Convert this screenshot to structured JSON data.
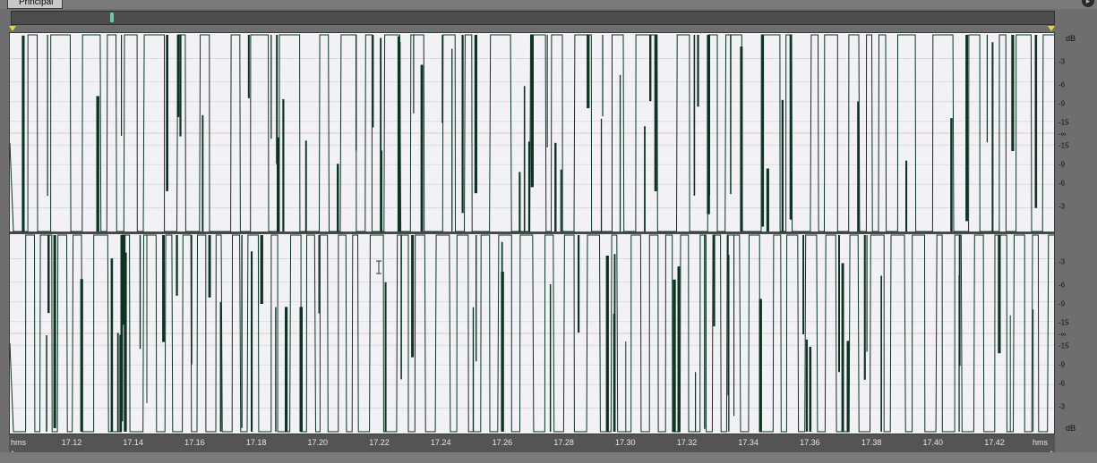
{
  "window": {
    "tab_label": "Principal"
  },
  "channels": [
    {
      "db_unit": "dB",
      "db_labels": [
        "-3",
        "-6",
        "-9",
        "-15",
        "-∞",
        "-15",
        "-9",
        "-6",
        "-3"
      ]
    },
    {
      "db_labels": [
        "-3",
        "-6",
        "-9",
        "-15",
        "-∞",
        "-15",
        "-9",
        "-6",
        "-3"
      ]
    }
  ],
  "time_ruler": {
    "unit_left": "hms",
    "unit_right": "hms",
    "ticks": [
      "17.12",
      "17.14",
      "17.16",
      "17.18",
      "17.20",
      "17.22",
      "17.24",
      "17.26",
      "17.28",
      "17.30",
      "17.32",
      "17.34",
      "17.36",
      "17.38",
      "17.40",
      "17.42"
    ]
  },
  "db_unit_bottom": "dB",
  "colors": {
    "waveform": "#0f3323",
    "background": "#f2f2f6",
    "gridline_red": "#e0b4b4",
    "gridline_gray": "#c9c9d2"
  }
}
